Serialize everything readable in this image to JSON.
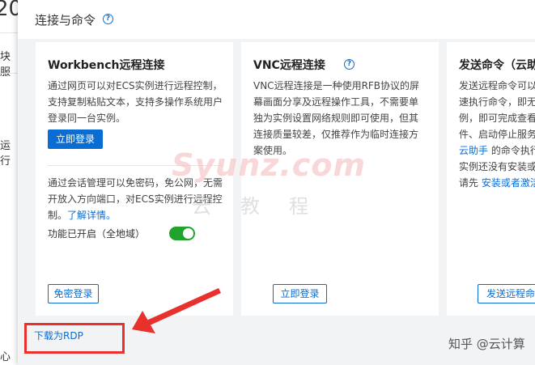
{
  "background": {
    "year_fragment": "20",
    "text1": "块服",
    "text2": "运行",
    "text3": "心服"
  },
  "drawer": {
    "title": "连接与命令",
    "title_help": "?"
  },
  "cards": {
    "workbench": {
      "title": "Workbench远程连接",
      "description": "通过网页可以对ECS实例进行远程控制，支持复制粘贴文本，支持多操作系统用户登录同一台实例。",
      "login_button": "立即登录",
      "session_text": "通过会话管理可以免密码，免公网，无需开放入方向端口，对ECS实例进行远程控制。",
      "session_link": "了解详情。",
      "toggle_label": "功能已开启（全地域）",
      "toggle_state": "on",
      "free_login_button": "免密登录"
    },
    "vnc": {
      "title": "VNC远程连接",
      "help": "?",
      "description": "VNC远程连接是一种使用RFB协议的屏幕画面分享及远程操作工具，不需要单独为实例设置网络规则即可使用，但其连接质量较差，仅推荐作为临时连接方案使用。",
      "login_button": "立即登录"
    },
    "send_command": {
      "title": "发送命令（云助",
      "desc_lines": [
        "发送远程命令可以",
        "速执行命令，即无",
        "例，即可完成查看",
        "件、启动停止服务",
        "云助手",
        " 的命令执行",
        "实例还没有安装或",
        "请先 ",
        "安装或者激活"
      ],
      "send_button": "发送远程命令"
    }
  },
  "rdp_link": "下载为RDP",
  "watermark": "Syunz.com",
  "watermark_sub": "云教程",
  "zhihu_credit": "知乎 @云计算",
  "colors": {
    "accent": "#0a6dd4",
    "toggle_on": "#1fa32b",
    "annotation_red": "#e8302d"
  },
  "icons": [
    "help-icon",
    "arrow-annotation-icon"
  ]
}
